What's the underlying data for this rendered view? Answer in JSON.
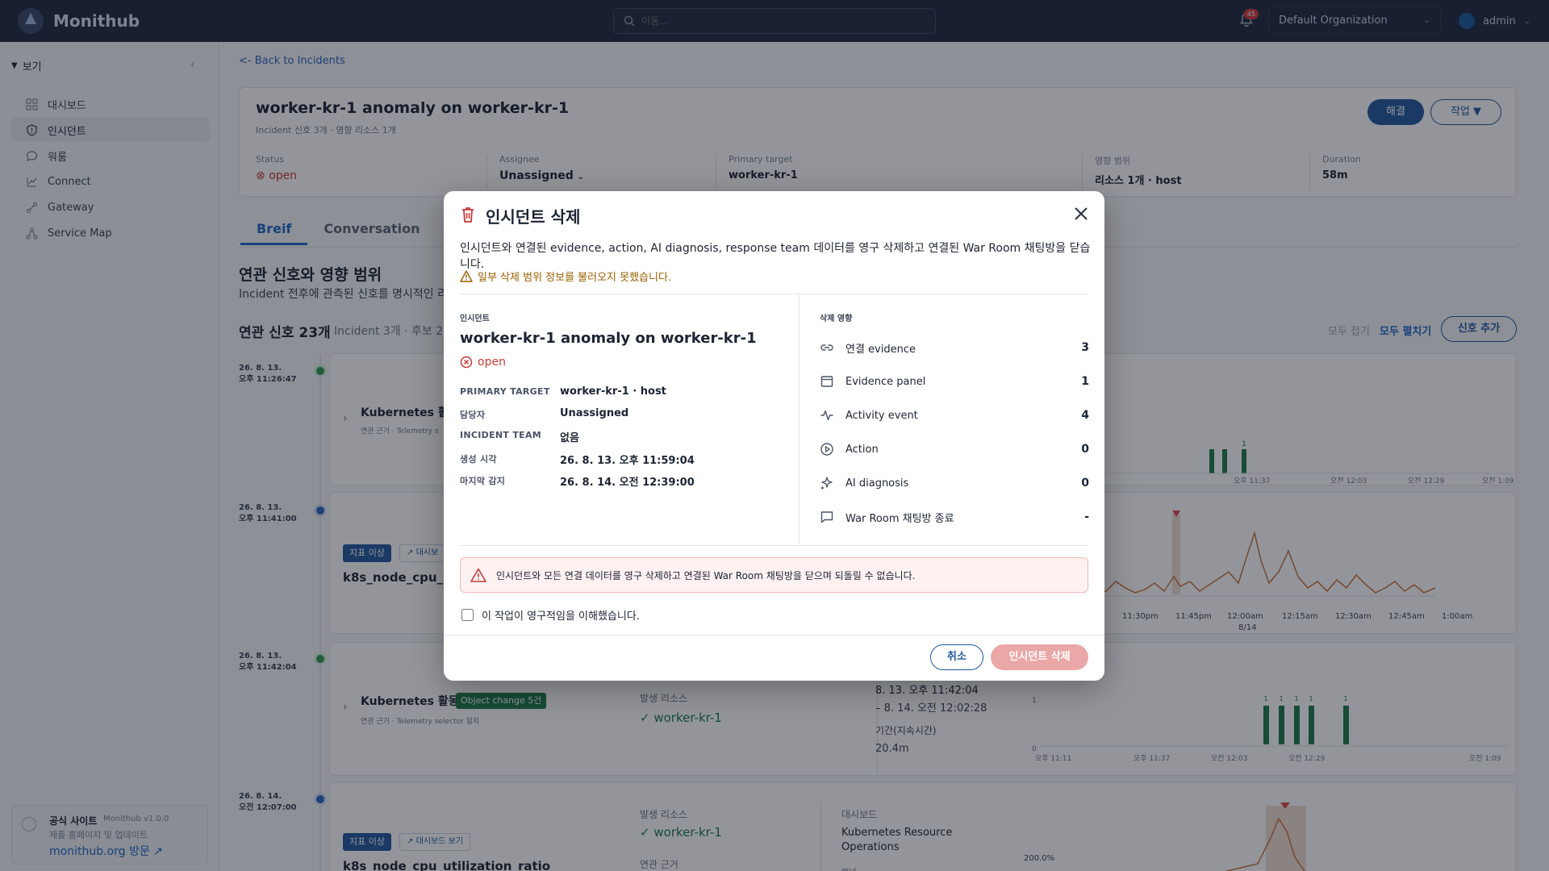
{
  "app": {
    "name": "Monithub"
  },
  "search": {
    "placeholder": "이동..."
  },
  "notifications": {
    "count": "45"
  },
  "org": {
    "name": "Default Organization"
  },
  "user": {
    "name": "admin"
  },
  "sidebar": {
    "section_label": "보기",
    "items": [
      {
        "label": "대시보드",
        "icon": "grid-icon"
      },
      {
        "label": "인시던트",
        "icon": "shield-icon"
      },
      {
        "label": "워룸",
        "icon": "chat-icon"
      },
      {
        "label": "Connect",
        "icon": "connect-icon"
      },
      {
        "label": "Gateway",
        "icon": "gateway-icon"
      },
      {
        "label": "Service Map",
        "icon": "service-map-icon"
      }
    ],
    "footer": {
      "title": "공식 사이트",
      "version": "Monithub v1.0.0",
      "subtitle": "제품 홈페이지 및 업데이트",
      "link": "monithub.org 방문"
    }
  },
  "incident": {
    "back_label": "<- Back to Incidents",
    "title": "worker-kr-1 anomaly on worker-kr-1",
    "subtitle": "Incident 신호 3개 · 영향 리소스 1개",
    "resolve_label": "해결",
    "action_label": "작업 ▼",
    "meta": [
      {
        "label": "Status",
        "value": "open"
      },
      {
        "label": "Assignee",
        "value": "Unassigned"
      },
      {
        "label": "Primary target",
        "value": "worker-kr-1"
      },
      {
        "label": "영향 범위",
        "value": "리소스 1개 · host"
      },
      {
        "label": "Duration",
        "value": "58m"
      }
    ]
  },
  "tabs": [
    {
      "label": "Breif"
    },
    {
      "label": "Conversation"
    }
  ],
  "section": {
    "title": "연관 신호와 영향 범위",
    "subtitle": "Incident 전후에 관측된 신호를 명시적인 리소",
    "signal_count": "연관 신호 23개",
    "signal_count_sub": "Incident 3개 · 후보 20",
    "collapse_all": "모두 접기",
    "expand_all": "모두 펼치기",
    "add_signal": "신호 추가"
  },
  "timeline": [
    {
      "date": "26. 8. 13.",
      "time": "오후 11:26:47"
    },
    {
      "date": "26. 8. 13.",
      "time": "오후 11:41:00"
    },
    {
      "date": "26. 8. 13.",
      "time": "오후 11:42:04"
    },
    {
      "date": "26. 8. 14.",
      "time": "오전 12:07:00"
    }
  ],
  "cards": {
    "c1_title": "Kubernetes 활동",
    "c1_sub": "연관 근거 · Telemetry s",
    "c2_tag": "지표 이상",
    "c2_dash": "대시보",
    "c2_title": "k8s_node_cpu_ut",
    "c3_title": "Kubernetes 활동",
    "c3_tag": "Object change 5건",
    "c3_sub": "연관 근거 · Telemetry selector 일치",
    "c3_res_label": "발생 리소스",
    "c3_res_value": "worker-kr-1",
    "c3_range1": "8. 13. 오후 11:42:04",
    "c3_range2": "– 8. 14. 오전 12:02:28",
    "c3_dur_label": "기간(지속시간)",
    "c3_dur_value": "20.4m",
    "c4_tag": "지표 이상",
    "c4_dash": "대시보드 보기",
    "c4_title": "k8s_node_cpu_utilization_ratio",
    "c4_res_label": "발생 리소스",
    "c4_res_value": "worker-kr-1",
    "c4_ev_label": "연관 근거",
    "c4_dashboard_label": "대시보드",
    "c4_dashboard_value1": "Kubernetes Resource",
    "c4_dashboard_value2": "Operations",
    "c4_panel_label": "패널",
    "c4_y_label": "200.0%"
  },
  "chart_c1": {
    "x_ticks": [
      "오후 11:37",
      "오전 12:03",
      "오전 12:29",
      "오전 1:09"
    ],
    "bar_label": "1"
  },
  "chart_c2": {
    "x_ticks": [
      "11:30pm",
      "11:45pm",
      "12:00am",
      "12:15am",
      "12:30am",
      "12:45am",
      "1:00am"
    ],
    "sub_tick": "8/14"
  },
  "chart_c3": {
    "x_ticks": [
      "오후 11:11",
      "오후 11:37",
      "오전 12:03",
      "오전 12:29",
      "오전 1:09"
    ],
    "y_ticks": [
      "1",
      "0"
    ],
    "bar_label": "1"
  },
  "modal": {
    "title": "인시던트 삭제",
    "description": "인시던트와 연결된 evidence, action, AI diagnosis, response team 데이터를 영구 삭제하고 연결된 War Room 채팅방을 닫습니다.",
    "warning": "일부 삭제 범위 정보를 불러오지 못했습니다.",
    "incident_label": "인시던트",
    "incident_title": "worker-kr-1 anomaly on worker-kr-1",
    "status": "open",
    "fields": [
      {
        "key": "PRIMARY TARGET",
        "value": "worker-kr-1 · host"
      },
      {
        "key": "담당자",
        "value": "Unassigned"
      },
      {
        "key": "INCIDENT TEAM",
        "value": "없음"
      },
      {
        "key": "생성 시각",
        "value": "26. 8. 13. 오후 11:59:04"
      },
      {
        "key": "마지막 감지",
        "value": "26. 8. 14. 오전 12:39:00"
      }
    ],
    "impact_label": "삭제 영향",
    "impacts": [
      {
        "label": "연결 evidence",
        "value": "3",
        "icon": "link-icon"
      },
      {
        "label": "Evidence panel",
        "value": "1",
        "icon": "panel-icon"
      },
      {
        "label": "Activity event",
        "value": "4",
        "icon": "activity-icon"
      },
      {
        "label": "Action",
        "value": "0",
        "icon": "play-icon"
      },
      {
        "label": "AI diagnosis",
        "value": "0",
        "icon": "sparkle-icon"
      },
      {
        "label": "War Room 채팅방 종료",
        "value": "-",
        "icon": "chat-icon"
      }
    ],
    "danger": "인시던트와 모든 연결 데이터를 영구 삭제하고 연결된 War Room 채팅방을 닫으며 되돌릴 수 없습니다.",
    "confirm_label": "이 작업이 영구적임을 이해했습니다.",
    "cancel_label": "취소",
    "delete_label": "인시던트 삭제"
  }
}
